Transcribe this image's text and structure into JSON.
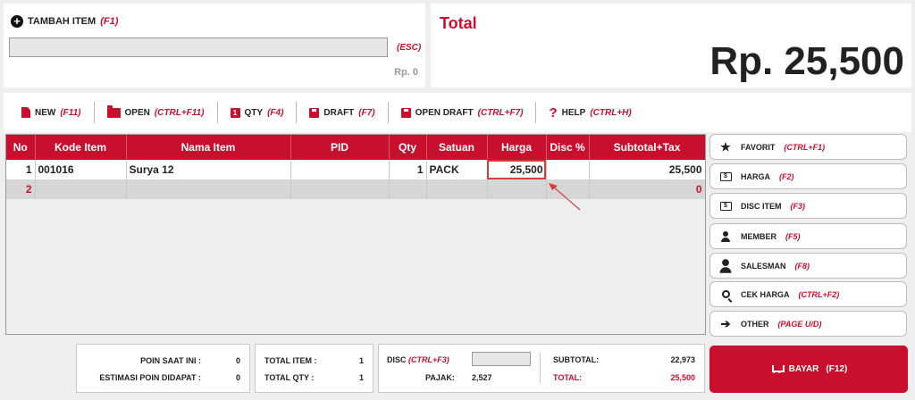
{
  "add_item": {
    "title": "TAMBAH ITEM",
    "hotkey": "(F1)",
    "input_value": "",
    "esc_label": "(ESC)",
    "price_preview": "Rp. 0"
  },
  "total": {
    "label": "Total",
    "value": "Rp. 25,500"
  },
  "toolbar": [
    {
      "label": "NEW",
      "hotkey": "(F11)",
      "icon": "new-document-icon"
    },
    {
      "label": "OPEN",
      "hotkey": "(CTRL+F11)",
      "icon": "folder-icon"
    },
    {
      "label": "QTY",
      "hotkey": "(F4)",
      "icon": "qty-number-icon"
    },
    {
      "label": "DRAFT",
      "hotkey": "(F7)",
      "icon": "save-icon"
    },
    {
      "label": "OPEN DRAFT",
      "hotkey": "(CTRL+F7)",
      "icon": "save-icon"
    },
    {
      "label": "HELP",
      "hotkey": "(CTRL+H)",
      "icon": "question-icon"
    }
  ],
  "table": {
    "columns": [
      "No",
      "Kode Item",
      "Nama Item",
      "PID",
      "Qty",
      "Satuan",
      "Harga",
      "Disc %",
      "Subtotal+Tax"
    ],
    "rows": [
      {
        "no": "1",
        "kode": "001016",
        "nama": "Surya 12",
        "pid": "",
        "qty": "1",
        "satuan": "PACK",
        "harga": "25,500",
        "disc": "",
        "subtotal": "25,500"
      },
      {
        "no": "2",
        "kode": "",
        "nama": "",
        "pid": "",
        "qty": "",
        "satuan": "",
        "harga": "",
        "disc": "",
        "subtotal": "0"
      }
    ]
  },
  "side_buttons": [
    {
      "label": "FAVORIT",
      "hotkey": "(CTRL+F1)",
      "icon": "star-icon"
    },
    {
      "label": "HARGA",
      "hotkey": "(F2)",
      "icon": "price-tag-icon"
    },
    {
      "label": "DISC ITEM",
      "hotkey": "(F3)",
      "icon": "discount-icon"
    },
    {
      "label": "MEMBER",
      "hotkey": "(F5)",
      "icon": "member-icon"
    },
    {
      "label": "SALESMAN",
      "hotkey": "(F8)",
      "icon": "salesman-icon"
    },
    {
      "label": "CEK HARGA",
      "hotkey": "(CTRL+F2)",
      "icon": "search-icon"
    },
    {
      "label": "OTHER",
      "hotkey": "(PAGE U/D)",
      "icon": "arrow-right-icon"
    }
  ],
  "summary": {
    "poin_label": "POIN SAAT INI :",
    "poin_value": "0",
    "estimasi_label": "ESTIMASI POIN DIDAPAT :",
    "estimasi_value": "0",
    "total_item_label": "TOTAL ITEM :",
    "total_item_value": "1",
    "total_qty_label": "TOTAL QTY :",
    "total_qty_value": "1",
    "disc_label": "DISC",
    "disc_hotkey": "(CTRL+F3)",
    "disc_value": "",
    "pajak_label": "PAJAK:",
    "pajak_value": "2,527",
    "subtotal_label": "SUBTOTAL:",
    "subtotal_value": "22,973",
    "total_label": "TOTAL:",
    "total_value": "25,500"
  },
  "bayar": {
    "label": "BAYAR",
    "hotkey": "(F12)"
  },
  "colors": {
    "accent": "#c8102e",
    "background": "#efefef",
    "row_alt": "#d6d6d6"
  }
}
